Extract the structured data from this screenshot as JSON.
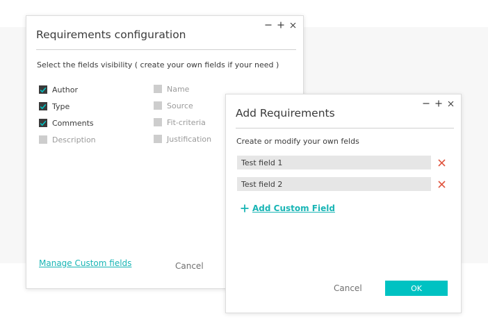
{
  "requirements_dialog": {
    "title": "Requirements configuration",
    "subtitle": "Select the fields visibility ( create your own fields if your need )",
    "fields_left": [
      {
        "label": "Author",
        "checked": true
      },
      {
        "label": "Type",
        "checked": true
      },
      {
        "label": "Comments",
        "checked": true
      },
      {
        "label": "Description",
        "checked": false
      }
    ],
    "fields_right": [
      {
        "label": "Name",
        "checked": false
      },
      {
        "label": "Source",
        "checked": false
      },
      {
        "label": "Fit-criteria",
        "checked": false
      },
      {
        "label": "Justification",
        "checked": false
      }
    ],
    "manage_link": "Manage Custom fields",
    "cancel_label": "Cancel"
  },
  "add_dialog": {
    "title": "Add Requirements",
    "subtitle": "Create or modify your own felds",
    "fields": [
      {
        "value": "Test field 1"
      },
      {
        "value": "Test field 2"
      }
    ],
    "add_label": "Add Custom Field",
    "cancel_label": "Cancel",
    "ok_label": "OK"
  },
  "colors": {
    "accent": "#00c2c2",
    "link": "#19b5b5",
    "delete": "#e0533d",
    "checkbox_on": "#3a3a3a",
    "checkbox_off": "#cdcdcd"
  },
  "icons": {
    "minimize": "minimize-icon",
    "maximize": "plus-icon",
    "close": "close-icon",
    "check": "check-icon",
    "delete": "delete-x-icon",
    "add": "plus-icon"
  }
}
